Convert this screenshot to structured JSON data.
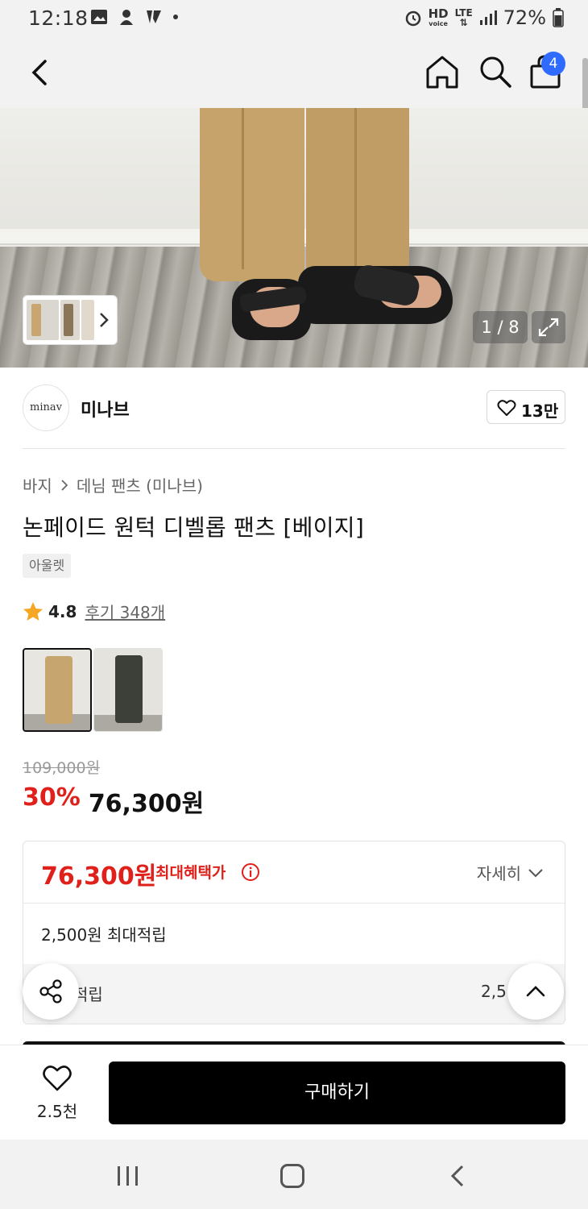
{
  "status_bar": {
    "time": "12:18",
    "battery": "72%",
    "hd_label": "HD",
    "voice_label": "voice",
    "lte_label": "LTE"
  },
  "header": {
    "back_icon": "chevron-left-icon",
    "home_icon": "home-icon",
    "search_icon": "search-icon",
    "cart_icon": "shopping-bag-icon",
    "cart_count": "4",
    "badge_color": "#2f6bff"
  },
  "gallery": {
    "page_counter": "1 / 8",
    "expand_icon": "expand-icon"
  },
  "brand": {
    "logo_text": "minav",
    "name": "미나브",
    "likes": "13만"
  },
  "product": {
    "breadcrumb": [
      "바지",
      "데님 팬츠 (미나브)"
    ],
    "title": "논페이드 원턱 디벨롭 팬츠 [베이지]",
    "badge": "아울렛",
    "rating": "4.8",
    "reviews": "후기 348개"
  },
  "pricing": {
    "original": "109,000원",
    "discount": "30%",
    "sale": "76,300원",
    "accent_color": "#e0201b"
  },
  "benefit": {
    "max_price": "76,300원",
    "max_label": "최대혜택가",
    "detail_label": "자세히",
    "points": "2,500원 최대적립",
    "accrual_label": "적립",
    "accrual_value": "2,5"
  },
  "bottom_bar": {
    "wish_count": "2.5천",
    "buy_label": "구매하기"
  }
}
